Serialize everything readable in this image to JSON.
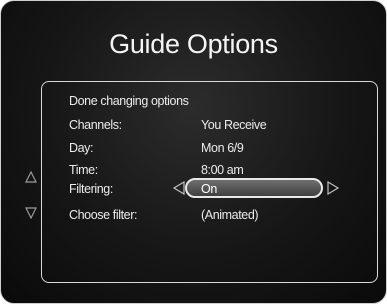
{
  "screen": {
    "title": "Guide Options"
  },
  "menu": {
    "done_label": "Done changing options",
    "rows": [
      {
        "label": "Channels:",
        "value": "You Receive"
      },
      {
        "label": "Day:",
        "value": "Mon 6/9"
      },
      {
        "label": "Time:",
        "value": "8:00 am"
      },
      {
        "label": "Filtering:",
        "value": "On"
      },
      {
        "label": "Choose filter:",
        "value": "(Animated)"
      }
    ],
    "selected_row": "Filtering"
  },
  "icons": {
    "scroll_up": "up-arrow-icon",
    "scroll_down": "down-arrow-icon",
    "value_left": "left-arrow-icon",
    "value_right": "right-arrow-icon"
  },
  "colors": {
    "background": "#161616",
    "text": "#ececec",
    "highlight_border": "#e8e8e8",
    "highlight_fill": "#5a5a5a"
  }
}
